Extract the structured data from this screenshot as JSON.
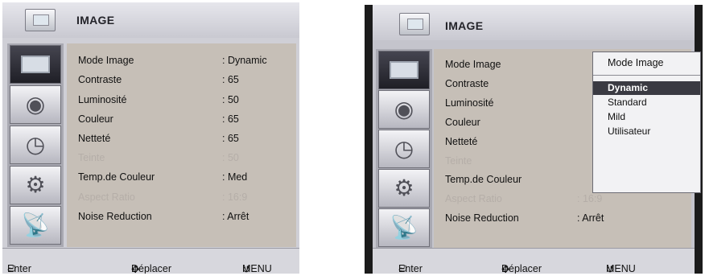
{
  "menu_title": "IMAGE",
  "rows": [
    {
      "label": "Mode Image",
      "value": ": Dynamic",
      "enabled": true
    },
    {
      "label": "Contraste",
      "value": ": 65",
      "enabled": true
    },
    {
      "label": "Luminosité",
      "value": ": 50",
      "enabled": true
    },
    {
      "label": "Couleur",
      "value": ": 65",
      "enabled": true
    },
    {
      "label": "Netteté",
      "value": ": 65",
      "enabled": true
    },
    {
      "label": "Teinte",
      "value": ": 50",
      "enabled": false
    },
    {
      "label": "Temp.de Couleur",
      "value": ": Med",
      "enabled": true
    },
    {
      "label": "Aspect Ratio",
      "value": ": 16:9",
      "enabled": false
    },
    {
      "label": "Noise Reduction",
      "value": ": Arrêt",
      "enabled": true
    }
  ],
  "sidebar_icons": [
    "tv-icon",
    "speaker-icon",
    "clock-icon",
    "gear-icon",
    "satellite-dish-icon"
  ],
  "footer": {
    "enter": "Enter",
    "move": "Déplacer",
    "menu": "MENU"
  },
  "popup": {
    "title": "Mode Image",
    "options": [
      "Dynamic",
      "Standard",
      "Mild",
      "Utilisateur"
    ],
    "selected": "Dynamic"
  },
  "colors": {
    "panel": "#c6bfb7",
    "highlight": "#3a3a42",
    "disabled_text": "#b5aea8"
  }
}
